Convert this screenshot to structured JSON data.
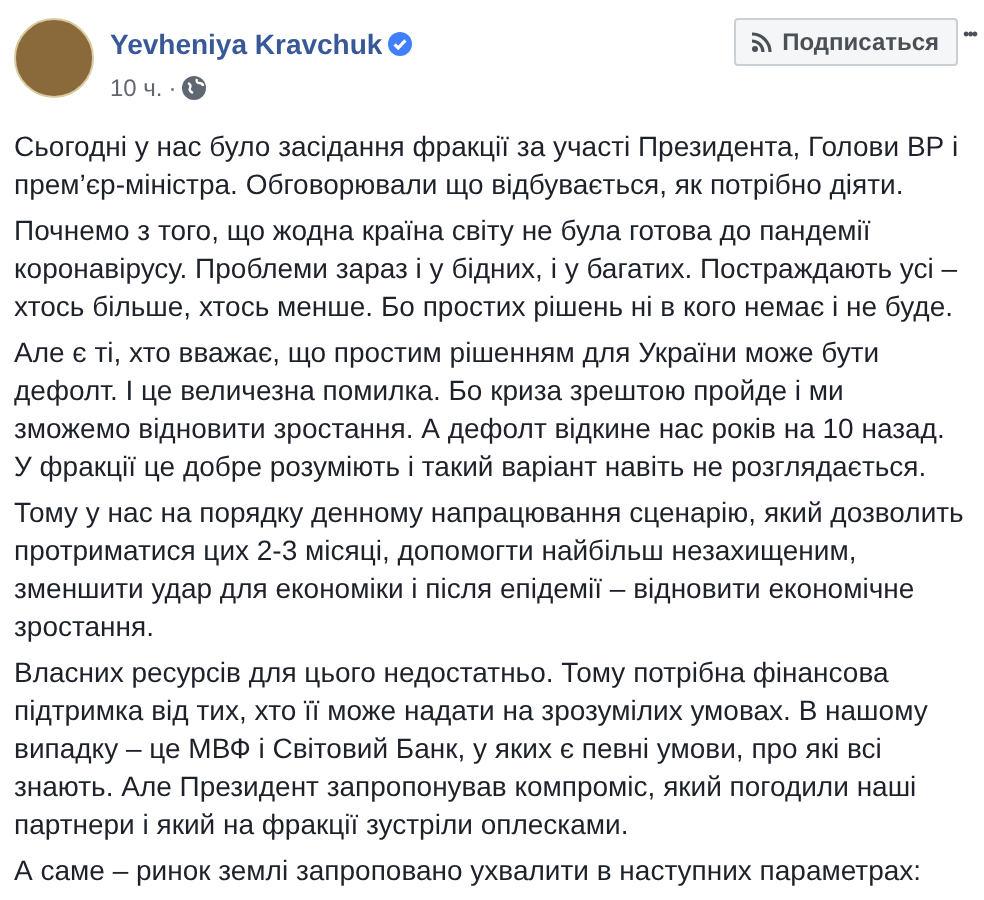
{
  "post": {
    "author": "Yevheniya Kravchuk",
    "verified": true,
    "time": "10 ч.",
    "separator": "·",
    "follow_button": "Подписаться",
    "more": "•••",
    "paragraphs": [
      "Сьогодні у нас було засідання фракції за участі Президента, Голови ВР і\nпрем’єр-міністра. Обговорювали що відбувається, як потрібно діяти.",
      "Почнемо з того, що жодна країна світу не була готова до пандемії\nкоронавірусу. Проблеми зараз і у бідних, і у багатих. Постраждають усі –\nхтось більше, хтось менше. Бо простих рішень ні в кого немає і не буде.",
      "Але є ті, хто вважає, що простим рішенням для України може бути\nдефолт. І це величезна помилка. Бо криза зрештою пройде і ми\nзможемо відновити зростання. А дефолт відкине нас років на 10 назад.\nУ фракції це добре розуміють і такий варіант навіть не розглядається.",
      "Тому у нас на порядку денному напрацювання сценарію, який дозволить\nпротриматися цих 2-3 місяці, допомогти найбільш незахищеним,\nзменшити удар для економіки і після епідемії – відновити економічне\nзростання.",
      "Власних ресурсів для цього недостатньо. Тому потрібна фінансова\nпідтримка від тих, хто її може надати на зрозумілих умовах. В нашому\nвипадку – це МВФ і Світовий Банк, у яких є певні умови, про які всі\nзнають. Але Президент запропонував компроміс, який погодили наші\nпартнери і який на фракції зустріли оплесками.",
      "А саме – ринок землі запроповано ухвалити в наступних параметрах:"
    ]
  }
}
